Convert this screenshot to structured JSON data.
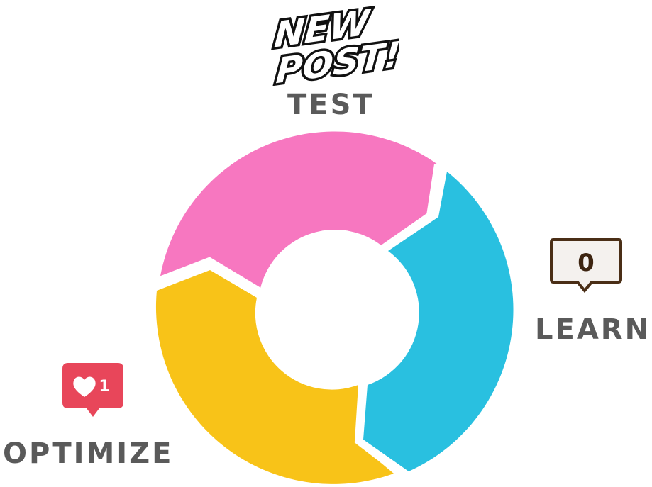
{
  "diagram": {
    "stages": [
      {
        "id": "test",
        "label": "TEST",
        "color": "#f777c0"
      },
      {
        "id": "learn",
        "label": "LEARN",
        "color": "#29c0e0"
      },
      {
        "id": "optimize",
        "label": "OPTIMIZE",
        "color": "#f8c318"
      }
    ],
    "new_post": {
      "line1": "NEW",
      "line2": "POST!"
    },
    "comment_badge": {
      "count": "0"
    },
    "like_badge": {
      "count": "1",
      "icon": "heart-icon",
      "color": "#e8465a"
    }
  }
}
